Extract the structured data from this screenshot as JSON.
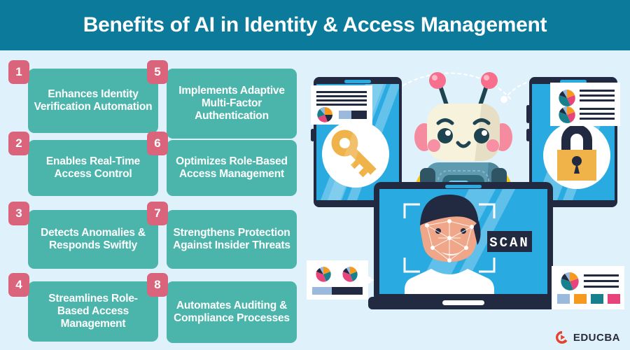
{
  "header": {
    "title": "Benefits of AI in Identity & Access Management",
    "background_color": "#0c7b9b",
    "text_color": "#ffffff"
  },
  "theme": {
    "page_background": "#dff1fb",
    "card_color": "#4cb5ab",
    "badge_color": "#d9647c",
    "accent_orange": "#f59a1e",
    "accent_pink": "#e8447c",
    "accent_teal": "#17808c",
    "accent_blue": "#29abe2",
    "dark_navy": "#222a41"
  },
  "benefits": [
    {
      "number": "1",
      "label": "Enhances Identity Verification Automation"
    },
    {
      "number": "2",
      "label": "Enables Real-Time Access Control"
    },
    {
      "number": "3",
      "label": "Detects Anomalies & Responds Swiftly"
    },
    {
      "number": "4",
      "label": "Streamlines Role-Based Access Management"
    },
    {
      "number": "5",
      "label": "Implements Adaptive Multi-Factor Authentication"
    },
    {
      "number": "6",
      "label": "Optimizes Role-Based Access Management"
    },
    {
      "number": "7",
      "label": "Strengthens Protection Against Insider Threats"
    },
    {
      "number": "8",
      "label": "Automates Auditing & Compliance Processes"
    }
  ],
  "illustration": {
    "robot": "ai-robot-mascot",
    "left_tablet_icon": "key-icon",
    "right_tablet_icon": "padlock-icon",
    "laptop_screen": {
      "subject": "face-recognition-portrait",
      "scan_label": "SCAN"
    },
    "doc_cards": [
      {
        "name": "doc-card-top-left",
        "contents": "text-lines-pie-chart-bars"
      },
      {
        "name": "doc-card-top-right",
        "contents": "two-pie-charts-text-lines"
      },
      {
        "name": "doc-card-bottom-left",
        "contents": "two-pie-charts-progress-bar"
      },
      {
        "name": "doc-card-bottom-right",
        "contents": "pie-chart-text-lines-swatches"
      }
    ]
  },
  "logo": {
    "brand": "EDUCBA",
    "mark": "educba-play-icon",
    "mark_color": "#e8412c"
  }
}
